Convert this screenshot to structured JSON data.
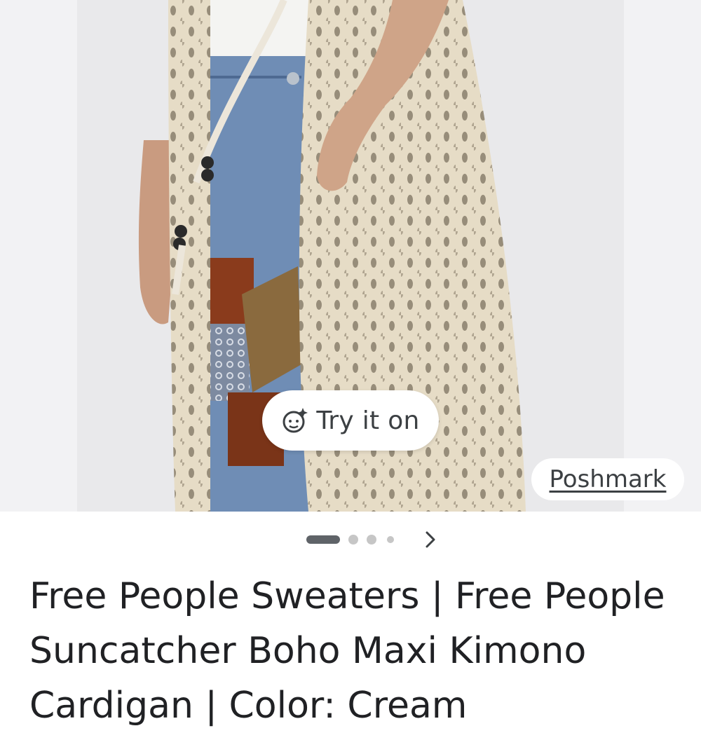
{
  "product_image": {
    "alt_icon": "product-photo"
  },
  "try_on_button": {
    "label": "Try it on",
    "icon": "try-on-face-sparkle-icon"
  },
  "source_badge": {
    "label": "Poshmark"
  },
  "carousel": {
    "total_dots": 4,
    "active_index": 0,
    "next_icon": "chevron-right-icon"
  },
  "listing": {
    "title": "Free People Sweaters | Free People Suncatcher Boho Maxi Kimono Cardigan | Color: Cream"
  },
  "colors": {
    "background": "#ffffff",
    "photo_backdrop": "#e8e8ea",
    "cardigan": "#e6dcc6",
    "denim": "#6f8db5",
    "text": "#202124",
    "pill_text": "#3c4043",
    "dot_active": "#5f6368",
    "dot_inactive": "#c6c6c6"
  }
}
